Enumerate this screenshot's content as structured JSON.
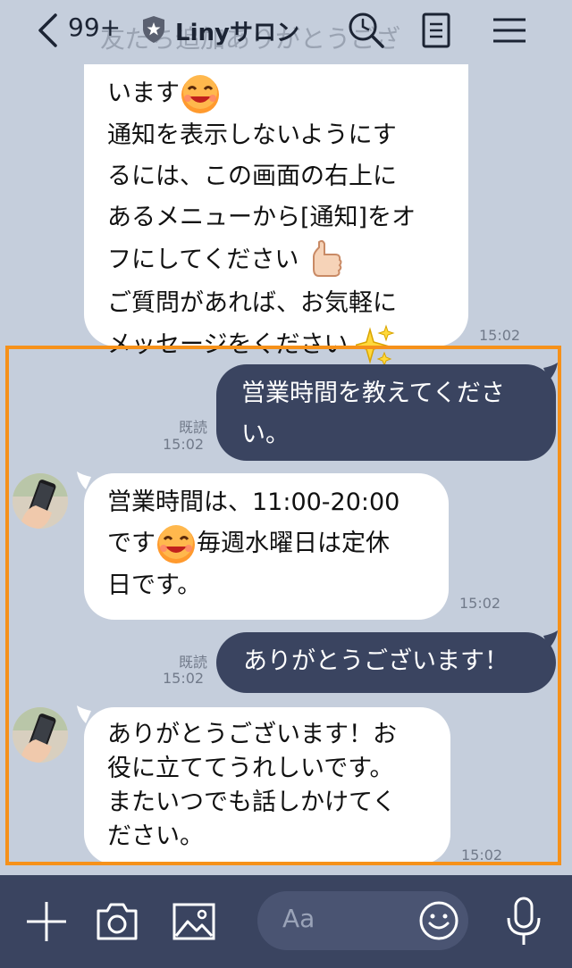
{
  "header": {
    "back_count": "99+",
    "title": "Linyサロン",
    "ghost_text": "友だち追加ありがとうござ"
  },
  "messages": [
    {
      "id": "m1",
      "dir": "in",
      "lines": [
        "います",
        "通知を表示しないようにす",
        "るには、この画面の右上に",
        "あるメニューから[通知]をオ",
        "フにしてください",
        "ご質問があれば、お気軽に",
        "メッセージをください"
      ],
      "time": "15:02",
      "emoji": [
        "grin-emoji",
        "thumbs-up-emoji",
        "sparkles-emoji"
      ]
    },
    {
      "id": "m2",
      "dir": "out",
      "lines": [
        "営業時間を教えてくださ",
        "い。"
      ],
      "read": "既読",
      "time": "15:02"
    },
    {
      "id": "m3",
      "dir": "in",
      "lines": [
        "営業時間は、11:00-20:00",
        "です",
        "毎週水曜日は定休",
        "日です。"
      ],
      "time": "15:02",
      "emoji": [
        "grin-emoji"
      ]
    },
    {
      "id": "m4",
      "dir": "out",
      "lines": [
        "ありがとうございます！"
      ],
      "read": "既読",
      "time": "15:02"
    },
    {
      "id": "m5",
      "dir": "in",
      "lines": [
        "ありがとうございます！お",
        "役に立ててうれしいです。",
        "またいつでも話しかけてく",
        "ださい。"
      ],
      "time": "15:02"
    }
  ],
  "input": {
    "placeholder": "Aa"
  },
  "colors": {
    "background": "#c5cedc",
    "outgoing_bubble": "#3a4460",
    "incoming_bubble": "#ffffff",
    "highlight": "#f6911a",
    "bar": "#3a4460"
  },
  "icons": [
    "back-chevron-icon",
    "shield-icon",
    "search-icon",
    "notes-icon",
    "menu-icon",
    "plus-icon",
    "camera-icon",
    "image-icon",
    "emoji-icon",
    "mic-icon"
  ]
}
